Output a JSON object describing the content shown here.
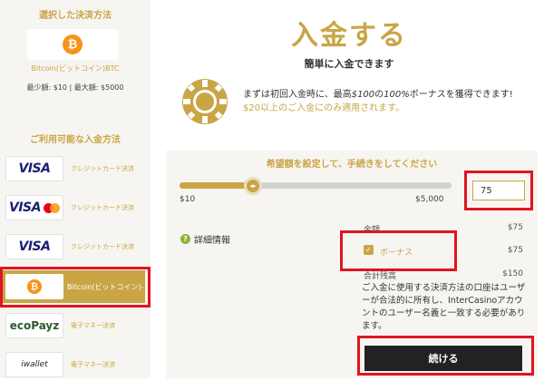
{
  "sidebar": {
    "selected_title": "選択した決済方法",
    "selected_method": "Bitcoin(ビットコイン)BTC",
    "minmax": "最少額: $10 | 最大額: $5000",
    "available_title": "ご利用可能な入金方法",
    "methods": [
      {
        "logo": "VISA",
        "label": "クレジットカード決済"
      },
      {
        "logo": "VISA",
        "label": "クレジットカード決済"
      },
      {
        "logo": "VISA",
        "label": "クレジットカード決済"
      },
      {
        "logo": "₿",
        "label": "Bitcoin(ビットコイン)-"
      },
      {
        "logo": "ecoPayz",
        "label": "電子マネー決済"
      },
      {
        "logo": "iwallet",
        "label": "電子マネー決済"
      }
    ]
  },
  "header": {
    "title": "入金する",
    "subtitle": "簡単に入金できます"
  },
  "promo": {
    "text1": "まずは初回入金時に、最高",
    "amount": "$100",
    "text2": "の",
    "percent": "100%",
    "text3": "ボーナスを獲得できます!",
    "condition": " $20以上のご入金にのみ適用されます。"
  },
  "deposit": {
    "panel_title": "希望額を設定して、手続きをしてください",
    "slider_min": "$10",
    "slider_max": "$5,000",
    "slider_fraction": 0.27,
    "amount_value": "75",
    "details_label": "詳細情報",
    "amount_label": "金額",
    "amount_val": "$75",
    "bonus_label": "ボーナス",
    "bonus_val": "$75",
    "total_label": "合計残高",
    "total_val": "$150",
    "notice": "ご入金に使用する決済方法の口座はユーザーが合法的に所有し、InterCasinoアカウントのユーザー名義と一致する必要があります。",
    "continue_label": "続ける"
  },
  "colors": {
    "gold": "#c9a545",
    "highlight": "#e01422"
  }
}
